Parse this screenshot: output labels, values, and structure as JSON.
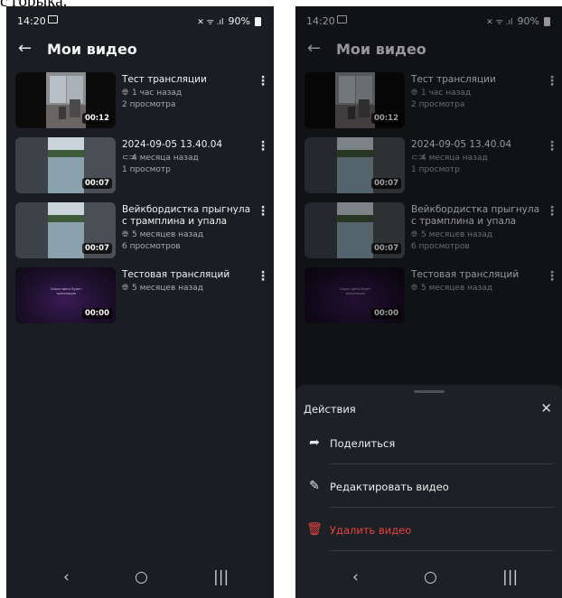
{
  "caption": "с горыка.",
  "status": {
    "time": "14:20",
    "signal": "✕ ᯤ .ıl",
    "battery": "90%"
  },
  "appbar": {
    "back": "←",
    "title": "Мои видео"
  },
  "videos": [
    {
      "title": "Тест трансляции",
      "meta1": "1 час назад",
      "meta1_icon": "globe-icon",
      "meta2": "2 просмотра",
      "duration": "00:12"
    },
    {
      "title": "2024-09-05 13.40.04",
      "meta1": "4 месяца назад",
      "meta1_icon": "link-icon",
      "meta2": "1 просмотр",
      "duration": "00:07"
    },
    {
      "title": "Вейкбордистка прыгнула с трамплина и упала",
      "meta1": "5 месяцев назад",
      "meta1_icon": "globe-icon",
      "meta2": "6 просмотров",
      "duration": "00:07"
    },
    {
      "title": "Тестовая трансляций",
      "meta1": "5 месяцев назад",
      "meta1_icon": "globe-icon",
      "meta2": "",
      "duration": "00:00",
      "thumb_text": "Скоро здесь будет трансляция"
    }
  ],
  "sheet": {
    "title": "Действия",
    "close": "✕",
    "actions": [
      {
        "label": "Поделиться",
        "icon": "share-icon"
      },
      {
        "label": "Редактировать видео",
        "icon": "pencil-icon"
      },
      {
        "label": "Удалить видео",
        "icon": "trash-icon",
        "danger": true
      }
    ]
  },
  "colors": {
    "background": "#1a1d22",
    "danger": "#e5433f",
    "text": "#f1f2f4",
    "muted": "#a8adb5"
  }
}
